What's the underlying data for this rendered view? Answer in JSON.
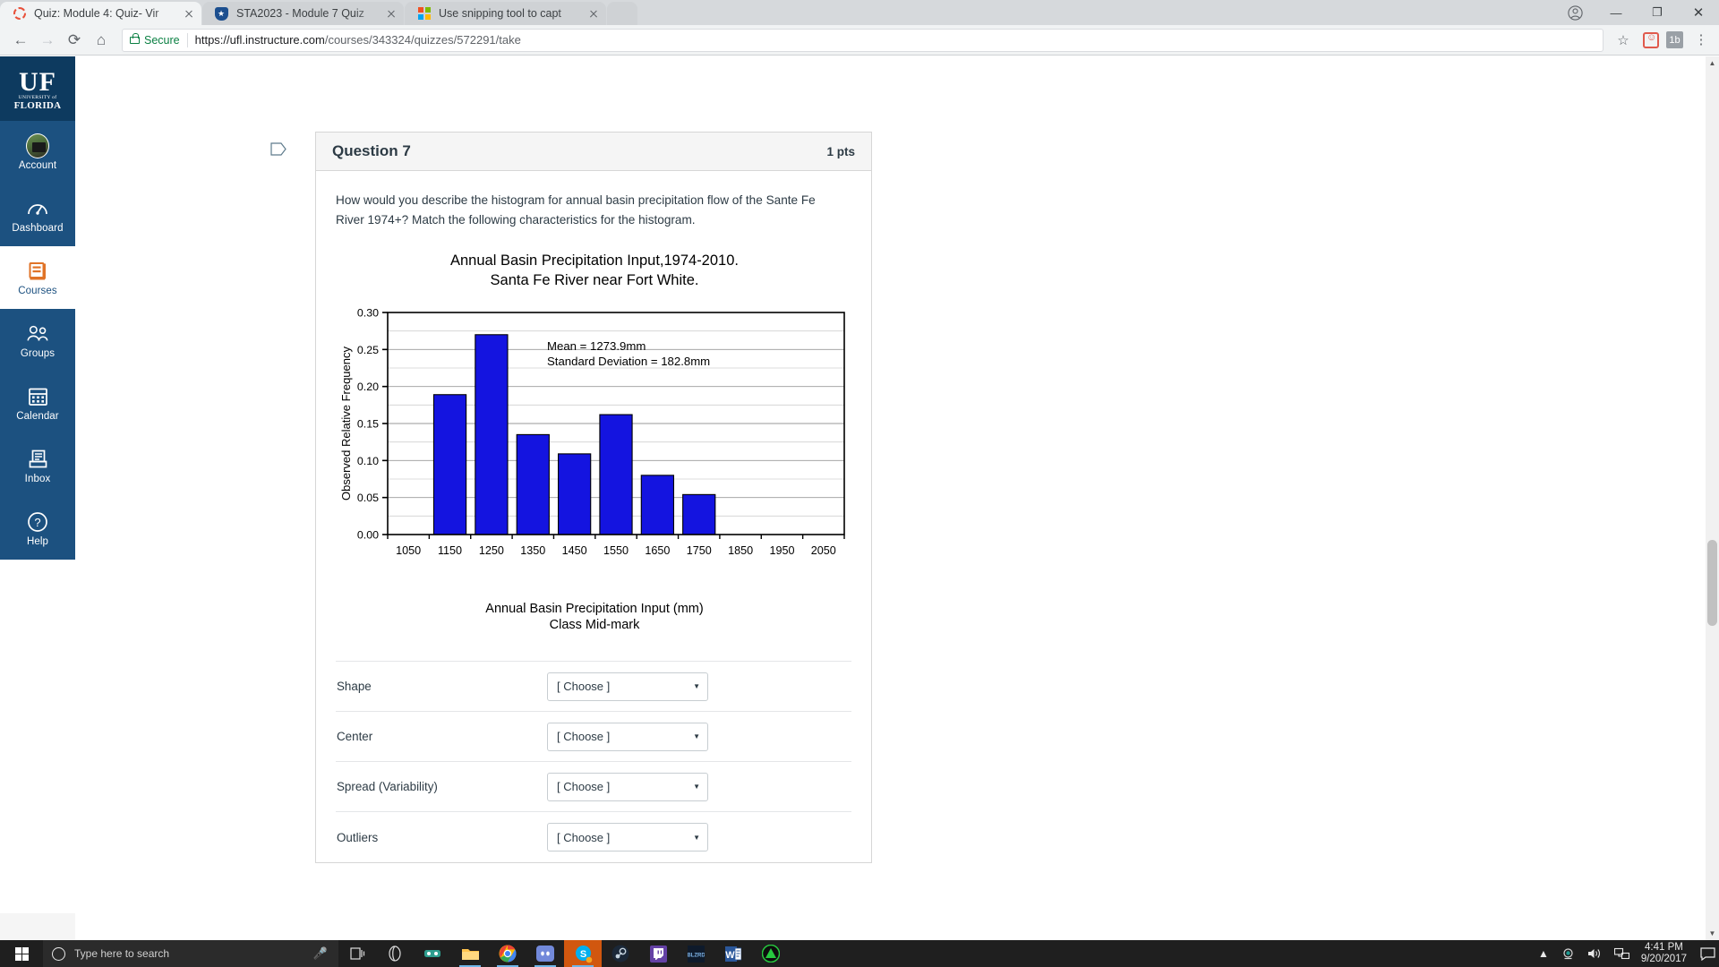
{
  "browser": {
    "tabs": [
      {
        "title": "Quiz: Module 4: Quiz- Vir",
        "favicon": "canvas-circle-icon",
        "active": true
      },
      {
        "title": "STA2023 - Module 7 Quiz",
        "favicon": "shield-star-icon",
        "active": false
      },
      {
        "title": "Use snipping tool to capt",
        "favicon": "microsoft-squares-icon",
        "active": false
      }
    ],
    "back_icon": "back-arrow-icon",
    "forward_icon": "forward-arrow-icon",
    "reload_icon": "reload-icon",
    "home_icon": "home-icon",
    "security_label": "Secure",
    "url_prefix": "https://ufl.instructure.com",
    "url_path": "/courses/343324/quizzes/572291/take",
    "bookmark_icon": "star-icon",
    "extension_1": "extension-icon",
    "extension_2": "1b",
    "menu_icon": "kebab-menu-icon",
    "profile_icon": "profile-icon",
    "minimize": "—",
    "maximize": "❐",
    "close": "✕"
  },
  "sidebar": {
    "logo": {
      "line1": "UF",
      "line2": "UNIVERSITY of",
      "line3": "FLORIDA"
    },
    "items": [
      {
        "label": "Account",
        "icon": "avatar-icon",
        "active": false
      },
      {
        "label": "Dashboard",
        "icon": "dashboard-gauge-icon",
        "active": false
      },
      {
        "label": "Courses",
        "icon": "courses-book-icon",
        "active": true
      },
      {
        "label": "Groups",
        "icon": "groups-people-icon",
        "active": false
      },
      {
        "label": "Calendar",
        "icon": "calendar-icon",
        "active": false
      },
      {
        "label": "Inbox",
        "icon": "inbox-tray-icon",
        "active": false
      },
      {
        "label": "Help",
        "icon": "help-question-icon",
        "active": false
      }
    ],
    "collapse_icon": "collapse-arrow-icon"
  },
  "question": {
    "flag_icon": "flag-icon",
    "title": "Question 7",
    "points": "1 pts",
    "prompt": "How would you describe the histogram for annual basin precipitation flow of the Sante Fe River 1974+? Match the following characteristics for the histogram."
  },
  "matching": {
    "placeholder": "[ Choose ]",
    "caret_icon": "chevron-down-icon",
    "rows": [
      {
        "label": "Shape",
        "value": "[ Choose ]"
      },
      {
        "label": "Center",
        "value": "[ Choose ]"
      },
      {
        "label": "Spread (Variability)",
        "value": "[ Choose ]"
      },
      {
        "label": "Outliers",
        "value": "[ Choose ]"
      }
    ]
  },
  "chart_data": {
    "type": "bar",
    "title": "Annual Basin Precipitation Input,1974-2010.",
    "subtitle": "Santa Fe River near Fort White.",
    "title_line1": "Annual Basin Precipitation Input,1974-2010.",
    "title_line2": "Santa Fe River near Fort White.",
    "xlabel": "Annual Basin Precipitation Input (mm)",
    "xlabel_line2": "Class Mid-mark",
    "ylabel": "Observed Relative Frequency",
    "categories": [
      1050,
      1150,
      1250,
      1350,
      1450,
      1550,
      1650,
      1750,
      1850,
      1950,
      2050
    ],
    "values": [
      0,
      0.189,
      0.27,
      0.135,
      0.109,
      0.162,
      0.08,
      0.054,
      0,
      0,
      0
    ],
    "xtick_labels": [
      "1050",
      "1150",
      "1250",
      "1350",
      "1450",
      "1550",
      "1650",
      "1750",
      "1850",
      "1950",
      "2050"
    ],
    "ytick_labels": [
      "0.00",
      "0.05",
      "0.10",
      "0.15",
      "0.20",
      "0.25",
      "0.30"
    ],
    "ytick_values": [
      0.0,
      0.05,
      0.1,
      0.15,
      0.2,
      0.25,
      0.3
    ],
    "minor_gridlines": [
      0.025,
      0.075,
      0.125,
      0.175,
      0.225,
      0.275
    ],
    "ylim": [
      0,
      0.3
    ],
    "grid": true,
    "legend": "none",
    "bar_color": "#1414e0",
    "bar_edge_color": "#000000",
    "annotations": [
      "Mean = 1273.9mm",
      "Standard Deviation = 182.8mm"
    ]
  },
  "taskbar": {
    "start_icon": "windows-start-icon",
    "search_placeholder": "Type here to search",
    "mic_icon": "microphone-icon",
    "taskview_icon": "task-view-icon",
    "cortana_icon": "cortana-icon",
    "apps": [
      {
        "name": "vr-headset-icon",
        "running": false
      },
      {
        "name": "file-explorer-icon",
        "running": true
      },
      {
        "name": "google-chrome-icon",
        "running": true
      },
      {
        "name": "discord-icon",
        "running": true
      },
      {
        "name": "skype-icon",
        "running": true,
        "active": true
      },
      {
        "name": "steam-icon",
        "running": false
      },
      {
        "name": "twitch-icon",
        "running": false
      },
      {
        "name": "blizzard-icon",
        "running": false
      },
      {
        "name": "word-icon",
        "running": false
      },
      {
        "name": "green-app-icon",
        "running": false
      }
    ],
    "tray": {
      "chevron_icon": "show-hidden-icons-icon",
      "webcam_icon": "webcam-icon",
      "volume_icon": "volume-icon",
      "network_icon": "network-icon",
      "time": "4:41 PM",
      "date": "9/20/2017",
      "action_center_icon": "action-center-icon"
    }
  }
}
